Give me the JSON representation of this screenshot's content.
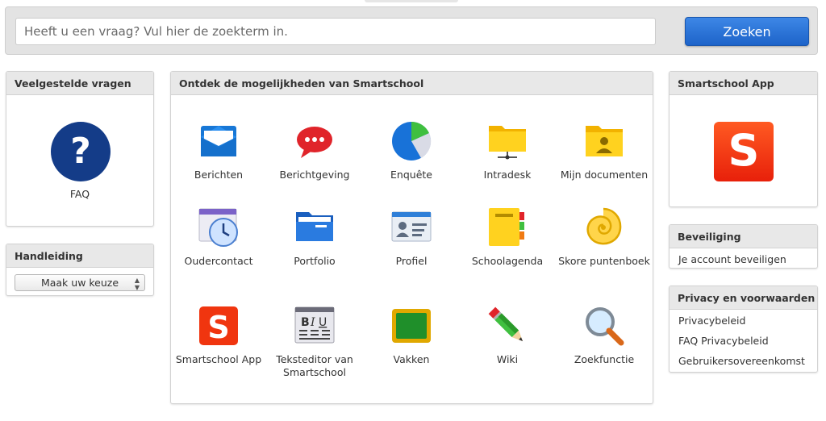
{
  "search": {
    "placeholder": "Heeft u een vraag? Vul hier de zoekterm in.",
    "button_label": "Zoeken"
  },
  "faq_panel": {
    "title": "Veelgestelde vragen",
    "item_label": "FAQ",
    "icon": "question-icon"
  },
  "manual_panel": {
    "title": "Handleiding",
    "select_value": "Maak uw keuze"
  },
  "main_panel": {
    "title": "Ontdek de mogelijkheden van Smartschool",
    "tiles": [
      {
        "label": "Berichten",
        "icon": "envelope-icon"
      },
      {
        "label": "Berichtgeving",
        "icon": "speech-bubble-icon"
      },
      {
        "label": "Enquête",
        "icon": "pie-chart-icon"
      },
      {
        "label": "Intradesk",
        "icon": "network-folder-icon"
      },
      {
        "label": "Mijn documenten",
        "icon": "user-folder-icon"
      },
      {
        "label": "Oudercontact",
        "icon": "calendar-clock-icon"
      },
      {
        "label": "Portfolio",
        "icon": "blue-folder-icon"
      },
      {
        "label": "Profiel",
        "icon": "id-card-icon"
      },
      {
        "label": "Schoolagenda",
        "icon": "agenda-book-icon"
      },
      {
        "label": "Skore puntenboek",
        "icon": "snail-shell-icon"
      },
      {
        "label": "Smartschool App",
        "icon": "smartschool-logo-icon"
      },
      {
        "label": "Teksteditor van Smartschool",
        "icon": "text-editor-icon"
      },
      {
        "label": "Vakken",
        "icon": "chalkboard-icon"
      },
      {
        "label": "Wiki",
        "icon": "pencil-icon"
      },
      {
        "label": "Zoekfunctie",
        "icon": "magnifier-icon"
      }
    ]
  },
  "app_panel": {
    "title": "Smartschool App",
    "logo_letter": "S"
  },
  "security_panel": {
    "title": "Beveiliging",
    "links": [
      "Je account beveiligen"
    ]
  },
  "privacy_panel": {
    "title": "Privacy en voorwaarden",
    "links": [
      "Privacybeleid",
      "FAQ Privacybeleid",
      "Gebruikersovereenkomst"
    ]
  },
  "colors": {
    "button_blue": "#1d63c9",
    "faq_navy": "#143c88",
    "brand_orange": "#f03a12",
    "panel_header_bg": "#e8e8e8"
  }
}
